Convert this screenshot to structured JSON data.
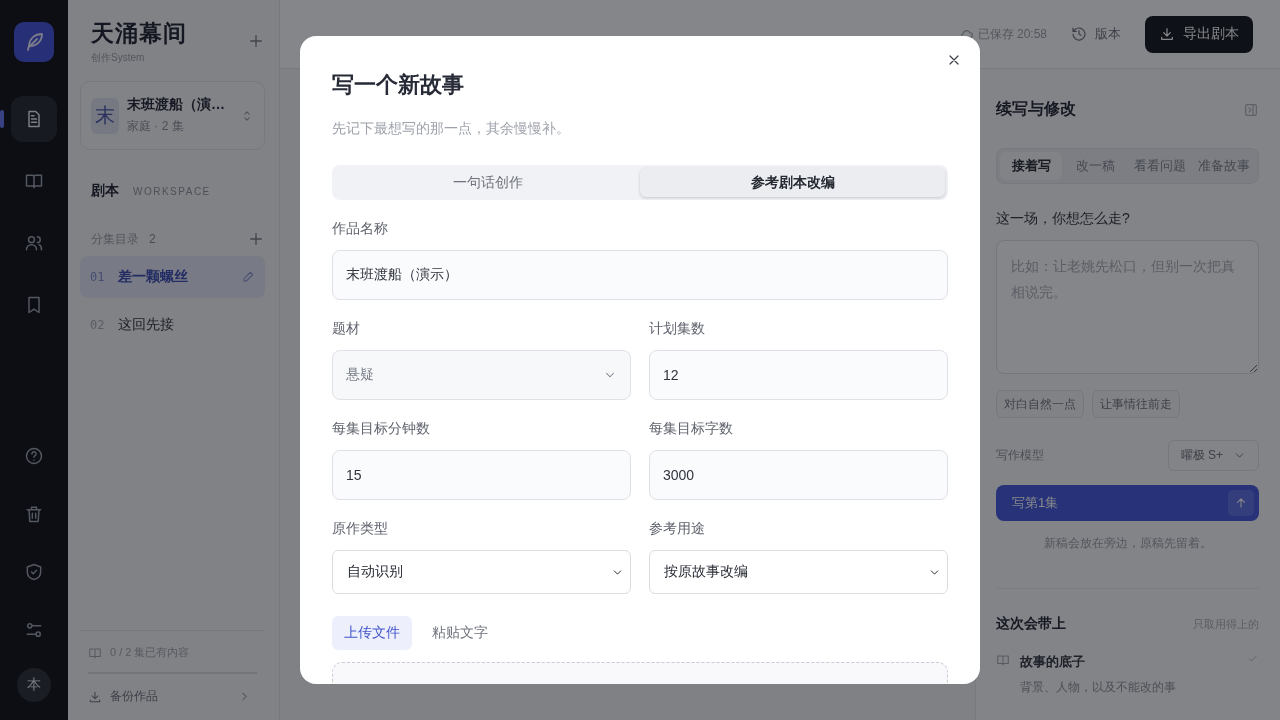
{
  "rail": {
    "items": [
      {
        "kind": "document",
        "selected": true
      },
      {
        "kind": "book",
        "selected": false
      },
      {
        "kind": "people",
        "selected": false
      },
      {
        "kind": "bookmark",
        "selected": false
      }
    ],
    "bottom_items": [
      {
        "kind": "help"
      },
      {
        "kind": "trash"
      },
      {
        "kind": "shield"
      },
      {
        "kind": "sliders"
      }
    ],
    "avatar": "本"
  },
  "sidebar": {
    "app_name": "天涌幕间",
    "app_subtitle": "创作System",
    "project": {
      "initial": "末",
      "title": "末班渡船（演…",
      "meta": "家庭 · 2 集"
    },
    "section": {
      "title": "剧本",
      "tag": "WORKSPACE"
    },
    "episodes_header": {
      "label": "分集目录",
      "count": "2"
    },
    "episodes": [
      {
        "number": "01",
        "title": "差一颗螺丝",
        "selected": true
      },
      {
        "number": "02",
        "title": "这回先接",
        "selected": false
      }
    ],
    "footer": {
      "progress": "0 / 2 集已有内容",
      "backup": "备份作品"
    }
  },
  "header": {
    "saved": "已保存 20:58",
    "versions": "版本",
    "export": "导出剧本"
  },
  "right_panel": {
    "title": "续写与修改",
    "tabs": [
      {
        "label": "接着写",
        "selected": true
      },
      {
        "label": "改一稿",
        "selected": false
      },
      {
        "label": "看看问题",
        "selected": false
      },
      {
        "label": "准备故事",
        "selected": false
      }
    ],
    "prompt_label": "这一场，你想怎么走?",
    "prompt": {
      "placeholder": "比如：让老姚先松口，但别一次把真相说完。"
    },
    "chips": [
      "对白自然一点",
      "让事情往前走"
    ],
    "model_label": "写作模型",
    "model": "曜极 S+",
    "write_button": "写第1集",
    "note": "新稿会放在旁边，原稿先留着。",
    "context": {
      "title": "这次会带上",
      "hint": "只取用得上的",
      "items": [
        {
          "title": "故事的底子",
          "desc": "背景、人物，以及不能改的事",
          "checked": true
        }
      ]
    }
  },
  "modal": {
    "title": "写一个新故事",
    "subtitle": "先记下最想写的那一点，其余慢慢补。",
    "modes": [
      {
        "label": "一句话创作",
        "selected": false
      },
      {
        "label": "参考剧本改编",
        "selected": true
      }
    ],
    "field_rows": [
      [
        {
          "label": "作品名称",
          "value": "末班渡船（演示）",
          "kind": "input"
        }
      ],
      [
        {
          "label": "题材",
          "value": "悬疑",
          "kind": "select"
        },
        {
          "label": "计划集数",
          "value": "12",
          "kind": "input"
        }
      ],
      [
        {
          "label": "每集目标分钟数",
          "value": "15",
          "kind": "input"
        },
        {
          "label": "每集目标字数",
          "value": "3000",
          "kind": "input"
        }
      ],
      [
        {
          "label": "原作类型",
          "value": "自动识别",
          "kind": "native-select"
        },
        {
          "label": "参考用途",
          "value": "按原故事改编",
          "kind": "native-select"
        }
      ]
    ],
    "source_tabs": [
      {
        "label": "上传文件",
        "selected": true
      },
      {
        "label": "粘贴文字",
        "selected": false
      }
    ]
  }
}
